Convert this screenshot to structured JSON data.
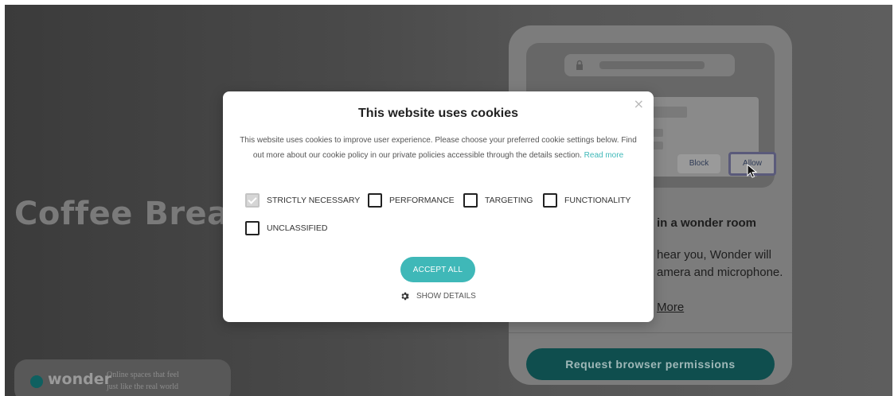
{
  "background": {
    "headline": "Coffee Brea",
    "phone": {
      "popup_buttons": {
        "block": "Block",
        "allow": "Allow"
      },
      "heading": "in a wonder room",
      "body_lines": [
        "hear you, Wonder will",
        "amera and microphone."
      ],
      "more_link": "More",
      "request_button": "Request browser permissions"
    },
    "brand": {
      "name": "wonder",
      "tagline_line1": "Online spaces that feel",
      "tagline_line2": "just like the real world"
    }
  },
  "cookie_modal": {
    "title": "This website uses cookies",
    "description": "This website uses cookies to improve user experience. Please choose your preferred cookie settings below. Find out more about our cookie policy in our private policies accessible through the details section.",
    "read_more": "Read more",
    "close_symbol": "×",
    "options": [
      {
        "label": "STRICTLY NECESSARY",
        "checked": true
      },
      {
        "label": "PERFORMANCE",
        "checked": false
      },
      {
        "label": "TARGETING",
        "checked": false
      },
      {
        "label": "FUNCTIONALITY",
        "checked": false
      },
      {
        "label": "UNCLASSIFIED",
        "checked": false
      }
    ],
    "accept_all": "ACCEPT ALL",
    "show_details": "SHOW DETAILS"
  },
  "colors": {
    "accent": "#3fb8b8",
    "modal_bg": "#ffffff",
    "request_button_bg": "#0f4e4e"
  }
}
